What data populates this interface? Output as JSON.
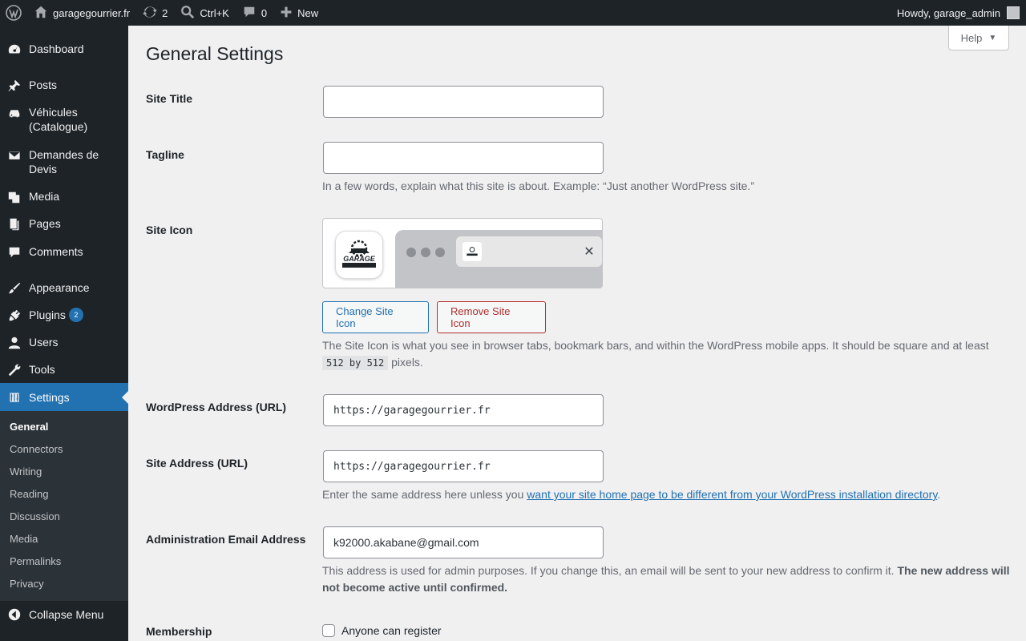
{
  "adminbar": {
    "site_name": "garagegourrier.fr",
    "updates_count": "2",
    "search_shortcut": "Ctrl+K",
    "comments_count": "0",
    "new_label": "New",
    "howdy": "Howdy, garage_admin"
  },
  "sidebar": {
    "items": [
      {
        "label": "Dashboard",
        "icon": "dashboard-icon"
      },
      {
        "label": "Posts",
        "icon": "pin-icon"
      },
      {
        "label": "Véhicules (Catalogue)",
        "icon": "car-icon"
      },
      {
        "label": "Demandes de Devis",
        "icon": "email-icon"
      },
      {
        "label": "Media",
        "icon": "media-icon"
      },
      {
        "label": "Pages",
        "icon": "pages-icon"
      },
      {
        "label": "Comments",
        "icon": "comment-icon"
      },
      {
        "label": "Appearance",
        "icon": "brush-icon"
      },
      {
        "label": "Plugins",
        "icon": "plugin-icon",
        "badge": "2"
      },
      {
        "label": "Users",
        "icon": "user-icon"
      },
      {
        "label": "Tools",
        "icon": "wrench-icon"
      },
      {
        "label": "Settings",
        "icon": "settings-icon"
      }
    ],
    "submenu": [
      "General",
      "Connectors",
      "Writing",
      "Reading",
      "Discussion",
      "Media",
      "Permalinks",
      "Privacy"
    ],
    "collapse_label": "Collapse Menu"
  },
  "help_label": "Help",
  "page_title": "General Settings",
  "fields": {
    "site_title": {
      "label": "Site Title",
      "value": ""
    },
    "tagline": {
      "label": "Tagline",
      "value": "",
      "description": "In a few words, explain what this site is about. Example: “Just another WordPress site.”"
    },
    "site_icon": {
      "label": "Site Icon",
      "change_label": "Change Site Icon",
      "remove_label": "Remove Site Icon",
      "description_part1": "The Site Icon is what you see in browser tabs, bookmark bars, and within the WordPress mobile apps. It should be square and at least",
      "size_code": "512 by 512",
      "description_part2": "pixels.",
      "logo_text": "GARAGE"
    },
    "wp_address": {
      "label": "WordPress Address (URL)",
      "value": "https://garagegourrier.fr"
    },
    "site_address": {
      "label": "Site Address (URL)",
      "value": "https://garagegourrier.fr",
      "desc_prefix": "Enter the same address here unless you",
      "desc_link": "want your site home page to be different from your WordPress installation directory",
      "desc_suffix": "."
    },
    "admin_email": {
      "label": "Administration Email Address",
      "value": "k92000.akabane@gmail.com",
      "desc_normal": "This address is used for admin purposes. If you change this, an email will be sent to your new address to confirm it.",
      "desc_bold": "The new address will not become active until confirmed."
    },
    "membership": {
      "label": "Membership",
      "checkbox_label": "Anyone can register",
      "checked": false
    }
  },
  "colors": {
    "accent": "#2271b1",
    "danger": "#b32d2e",
    "sidebar_bg": "#1d2327"
  }
}
